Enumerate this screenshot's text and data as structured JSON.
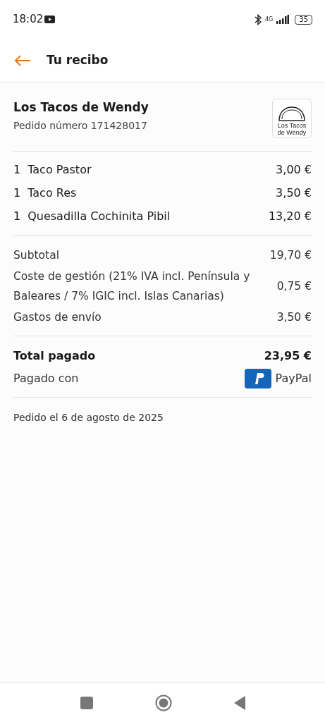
{
  "status_bar": {
    "time": "18:02",
    "network": "4G",
    "battery": "35"
  },
  "header": {
    "title": "Tu recibo"
  },
  "restaurant": {
    "name": "Los Tacos de Wendy",
    "order_number": "Pedido número 171428017",
    "logo_lines": [
      "Los Tacos",
      "de Wendy"
    ]
  },
  "items": [
    {
      "quantity": "1",
      "name": "Taco Pastor",
      "price": "3,00 €"
    },
    {
      "quantity": "1",
      "name": "Taco Res",
      "price": "3,50 €"
    },
    {
      "quantity": "1",
      "name": "Quesadilla Cochinita Pibil",
      "price": "13,20 €"
    }
  ],
  "charges": [
    {
      "label": "Subtotal",
      "amount": "19,70 €"
    },
    {
      "label": "Coste de gestión (21% IVA incl. Península y Baleares / 7% IGIC incl. Islas Canarias)",
      "amount": "0,75 €"
    },
    {
      "label": "Gastos de envío",
      "amount": "3,50 €"
    }
  ],
  "total": {
    "label": "Total pagado",
    "amount": "23,95 €"
  },
  "payment": {
    "label": "Pagado con",
    "method": "PayPal"
  },
  "order_date": "Pedido el 6 de agosto de 2025"
}
